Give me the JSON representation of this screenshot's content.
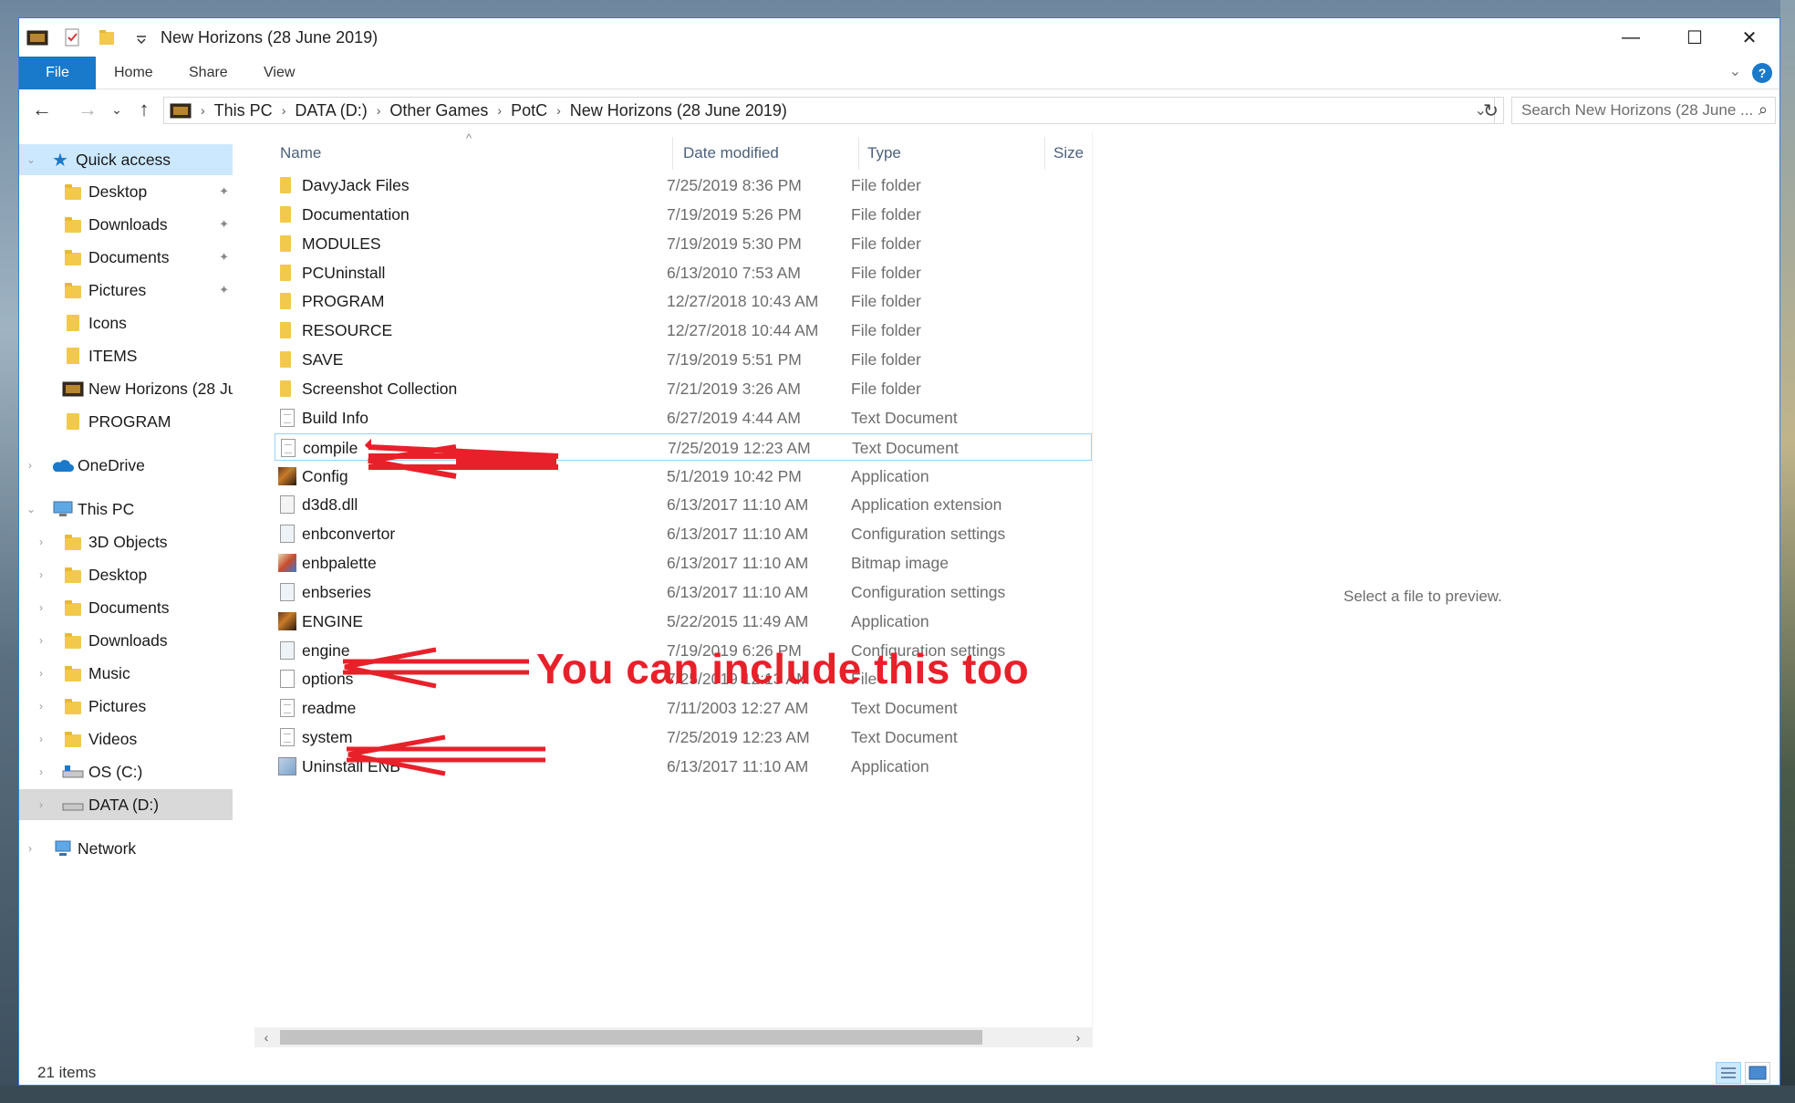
{
  "window": {
    "title": "New Horizons (28 June 2019)",
    "controls": {
      "minimize": "—",
      "maximize": "☐",
      "close": "✕"
    }
  },
  "ribbon": {
    "tabs": [
      "File",
      "Home",
      "Share",
      "View"
    ],
    "help": "?",
    "chevron": "⌄"
  },
  "nav": {
    "back": "←",
    "forward": "→",
    "recent": "⌄",
    "up": "↑",
    "breadcrumb": [
      "This PC",
      "DATA (D:)",
      "Other Games",
      "PotC",
      "New Horizons (28 June 2019)"
    ],
    "sep": "›",
    "dropdown": "⌄",
    "refresh": "↻",
    "search_placeholder": "Search New Horizons (28 June ...",
    "search_icon": "⌕"
  },
  "sidebar": {
    "quick_access": "Quick access",
    "quick_items": [
      {
        "label": "Desktop",
        "pinned": true
      },
      {
        "label": "Downloads",
        "pinned": true
      },
      {
        "label": "Documents",
        "pinned": true
      },
      {
        "label": "Pictures",
        "pinned": true
      },
      {
        "label": "Icons",
        "pinned": false
      },
      {
        "label": "ITEMS",
        "pinned": false
      },
      {
        "label": "New Horizons (28 Ju",
        "pinned": false
      },
      {
        "label": "PROGRAM",
        "pinned": false
      }
    ],
    "onedrive": "OneDrive",
    "this_pc": "This PC",
    "pc_items": [
      "3D Objects",
      "Desktop",
      "Documents",
      "Downloads",
      "Music",
      "Pictures",
      "Videos",
      "OS (C:)",
      "DATA (D:)"
    ],
    "network": "Network",
    "pin_glyph": "📌"
  },
  "columns": {
    "name": "Name",
    "date": "Date modified",
    "type": "Type",
    "size": "Size",
    "sort": "^"
  },
  "files": [
    {
      "name": "DavyJack Files",
      "date": "7/25/2019 8:36 PM",
      "type": "File folder",
      "icon": "folder-icon"
    },
    {
      "name": "Documentation",
      "date": "7/19/2019 5:26 PM",
      "type": "File folder",
      "icon": "folder-icon"
    },
    {
      "name": "MODULES",
      "date": "7/19/2019 5:30 PM",
      "type": "File folder",
      "icon": "folder-icon"
    },
    {
      "name": "PCUninstall",
      "date": "6/13/2010 7:53 AM",
      "type": "File folder",
      "icon": "folder-icon"
    },
    {
      "name": "PROGRAM",
      "date": "12/27/2018 10:43 AM",
      "type": "File folder",
      "icon": "folder-icon"
    },
    {
      "name": "RESOURCE",
      "date": "12/27/2018 10:44 AM",
      "type": "File folder",
      "icon": "folder-icon"
    },
    {
      "name": "SAVE",
      "date": "7/19/2019 5:51 PM",
      "type": "File folder",
      "icon": "folder-icon"
    },
    {
      "name": "Screenshot Collection",
      "date": "7/21/2019 3:26 AM",
      "type": "File folder",
      "icon": "folder-icon"
    },
    {
      "name": "Build Info",
      "date": "6/27/2019 4:44 AM",
      "type": "Text Document",
      "icon": "text-file-icon"
    },
    {
      "name": "compile",
      "date": "7/25/2019 12:23 AM",
      "type": "Text Document",
      "icon": "text-file-icon"
    },
    {
      "name": "Config",
      "date": "5/1/2019 10:42 PM",
      "type": "Application",
      "icon": "app-icon"
    },
    {
      "name": "d3d8.dll",
      "date": "6/13/2017 11:10 AM",
      "type": "Application extension",
      "icon": "dll-icon"
    },
    {
      "name": "enbconvertor",
      "date": "6/13/2017 11:10 AM",
      "type": "Configuration settings",
      "icon": "config-file-icon"
    },
    {
      "name": "enbpalette",
      "date": "6/13/2017 11:10 AM",
      "type": "Bitmap image",
      "icon": "bitmap-icon"
    },
    {
      "name": "enbseries",
      "date": "6/13/2017 11:10 AM",
      "type": "Configuration settings",
      "icon": "config-file-icon"
    },
    {
      "name": "ENGINE",
      "date": "5/22/2015 11:49 AM",
      "type": "Application",
      "icon": "app-icon"
    },
    {
      "name": "engine",
      "date": "7/19/2019 6:26 PM",
      "type": "Configuration settings",
      "icon": "config-file-icon"
    },
    {
      "name": "options",
      "date": "7/25/2019 12:13 AM",
      "type": "File",
      "icon": "blank-file-icon"
    },
    {
      "name": "readme",
      "date": "7/11/2003 12:27 AM",
      "type": "Text Document",
      "icon": "text-file-icon"
    },
    {
      "name": "system",
      "date": "7/25/2019 12:23 AM",
      "type": "Text Document",
      "icon": "text-file-icon"
    },
    {
      "name": "Uninstall ENB",
      "date": "6/13/2017 11:10 AM",
      "type": "Application",
      "icon": "uninstall-app-icon"
    }
  ],
  "scroll": {
    "left": "‹",
    "right": "›"
  },
  "preview": {
    "message": "Select a file to preview."
  },
  "status": {
    "count": "21 items"
  },
  "annotation": {
    "text": "You can include this too",
    "color": "#e8202a"
  }
}
